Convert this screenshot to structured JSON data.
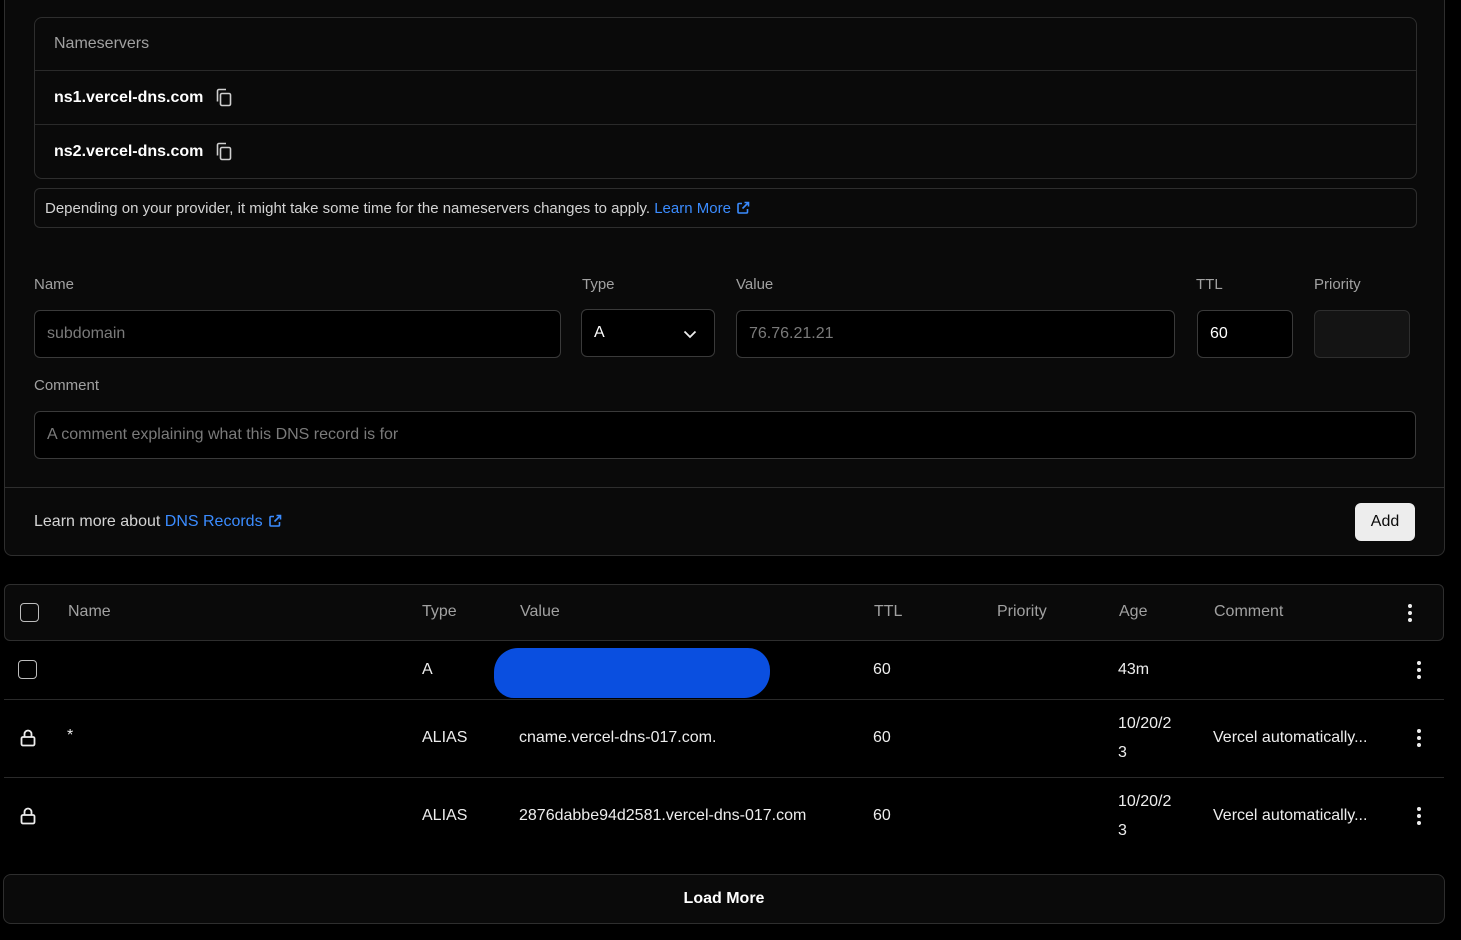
{
  "nameservers": {
    "heading": "Nameservers",
    "items": [
      "ns1.vercel-dns.com",
      "ns2.vercel-dns.com"
    ]
  },
  "notice": {
    "text": "Depending on your provider, it might take some time for the nameservers changes to apply.",
    "link": "Learn More"
  },
  "form": {
    "name_label": "Name",
    "name_placeholder": "subdomain",
    "type_label": "Type",
    "type_value": "A",
    "value_label": "Value",
    "value_placeholder": "76.76.21.21",
    "ttl_label": "TTL",
    "ttl_value": "60",
    "priority_label": "Priority",
    "comment_label": "Comment",
    "comment_placeholder": "A comment explaining what this DNS record is for"
  },
  "footer": {
    "text": "Learn more about",
    "link": "DNS Records",
    "add_label": "Add"
  },
  "table": {
    "headers": {
      "name": "Name",
      "type": "Type",
      "value": "Value",
      "ttl": "TTL",
      "priority": "Priority",
      "age": "Age",
      "comment": "Comment"
    },
    "rows": [
      {
        "name": "",
        "type": "A",
        "value": "",
        "ttl": "60",
        "priority": "",
        "age": "43m",
        "comment": ""
      },
      {
        "name": "*",
        "type": "ALIAS",
        "value": "cname.vercel-dns-017.com.",
        "ttl": "60",
        "priority": "",
        "age": "10/20/23",
        "comment": "Vercel automatically..."
      },
      {
        "name": "",
        "type": "ALIAS",
        "value": "2876dabbe94d2581.vercel-dns-017.com",
        "ttl": "60",
        "priority": "",
        "age": "10/20/23",
        "comment": "Vercel automatically..."
      }
    ]
  },
  "load_more": "Load More",
  "colors": {
    "link": "#3b8cff",
    "redaction": "#0a4fe0"
  }
}
